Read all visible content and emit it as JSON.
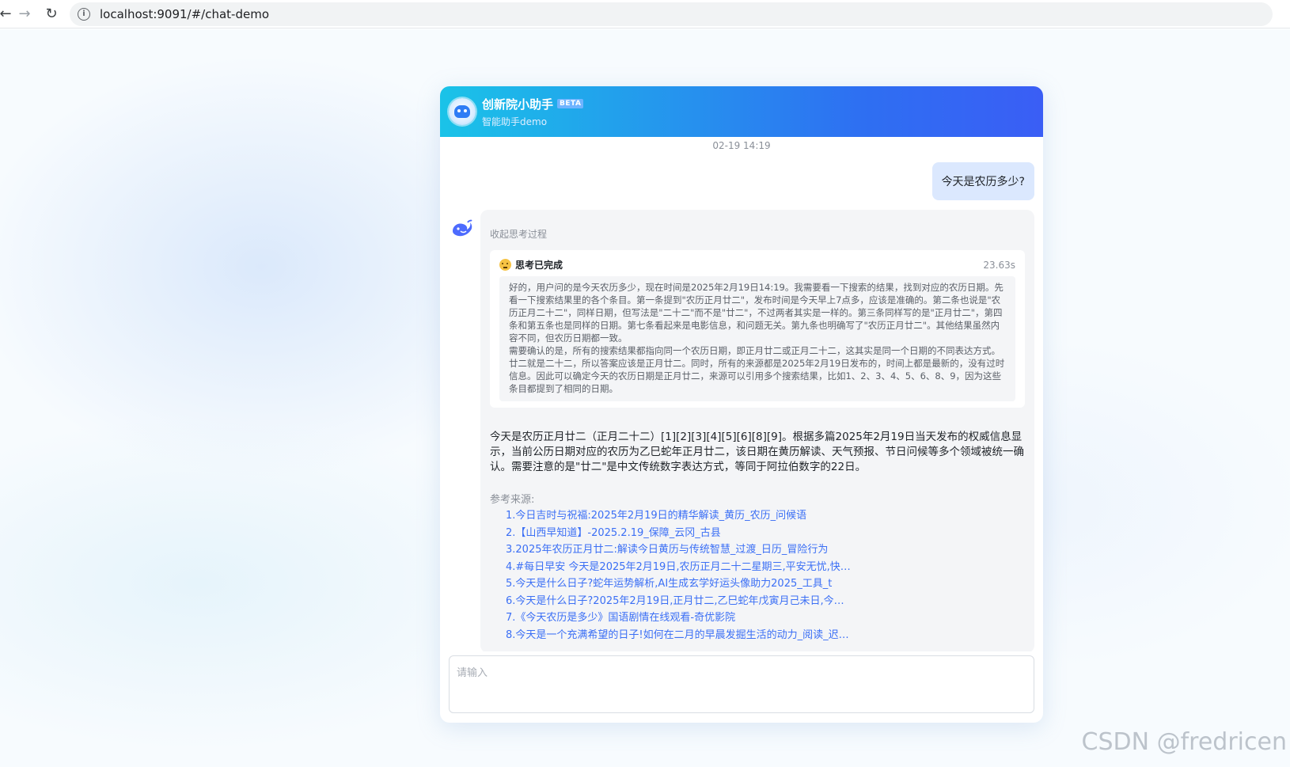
{
  "browser": {
    "back_icon": "arrow-left-icon",
    "forward_icon": "arrow-right-icon",
    "reload_icon": "reload-icon",
    "url": "localhost:9091/#/chat-demo"
  },
  "header": {
    "title": "创新院小助手",
    "badge": "BETA",
    "subtitle": "智能助手demo"
  },
  "conversation": {
    "timestamp": "02-19 14:19",
    "user_message": "今天是农历多少?",
    "assistant": {
      "collapse_label": "收起思考过程",
      "thinking_title": "思考已完成",
      "thinking_time": "23.63s",
      "thinking_paragraphs": [
        "好的，用户问的是今天农历多少，现在时间是2025年2月19日14:19。我需要看一下搜索的结果，找到对应的农历日期。先看一下搜索结果里的各个条目。第一条提到\"农历正月廿二\"，发布时间是今天早上7点多，应该是准确的。第二条也说是\"农历正月二十二\"，同样日期，但写法是\"二十二\"而不是\"廿二\"，不过两者其实是一样的。第三条同样写的是\"正月廿二\"，第四条和第五条也是同样的日期。第七条看起来是电影信息，和问题无关。第九条也明确写了\"农历正月廿二\"。其他结果虽然内容不同，但农历日期都一致。",
        "需要确认的是，所有的搜索结果都指向同一个农历日期，即正月廿二或正月二十二，这其实是同一个日期的不同表达方式。廿二就是二十二，所以答案应该是正月廿二。同时，所有的来源都是2025年2月19日发布的，时间上都是最新的，没有过时信息。因此可以确定今天的农历日期是正月廿二，来源可以引用多个搜索结果，比如1、2、3、4、5、6、8、9，因为这些条目都提到了相同的日期。"
      ],
      "answer": "今天是农历正月廿二（正月二十二）[1][2][3][4][5][6][8][9]。根据多篇2025年2月19日当天发布的权威信息显示，当前公历日期对应的农历为乙巳蛇年正月廿二，该日期在黄历解读、天气预报、节日问候等多个领域被统一确认。需要注意的是\"廿二\"是中文传统数字表达方式，等同于阿拉伯数字的22日。",
      "refs_label": "参考来源:",
      "refs": [
        "1.今日吉时与祝福:2025年2月19日的精华解读_黄历_农历_问候语",
        "2.【山西早知道】-2025.2.19_保障_云冈_古县",
        "3.2025年农历正月廿二:解读今日黄历与传统智慧_过渡_日历_冒险行为",
        "4.#每日早安 今天是2025年2月19日,农历正月二十二星期三,平安无忧,快乐常伴",
        "5.今天是什么日子?蛇年运势解析,AI生成玄学好运头像助力2025_工具_t",
        "6.今天是什么日子?2025年2月19日,正月廿二,乙巳蛇年戊寅月己未日,今天宜",
        "7.《今天农历是多少》国语剧情在线观看-奇优影院",
        "8.今天是一个充满希望的日子!如何在二月的早晨发掘生活的动力_阅读_迟迟_的力量"
      ]
    }
  },
  "input": {
    "placeholder": "请输入"
  },
  "watermark": "CSDN @fredricen"
}
